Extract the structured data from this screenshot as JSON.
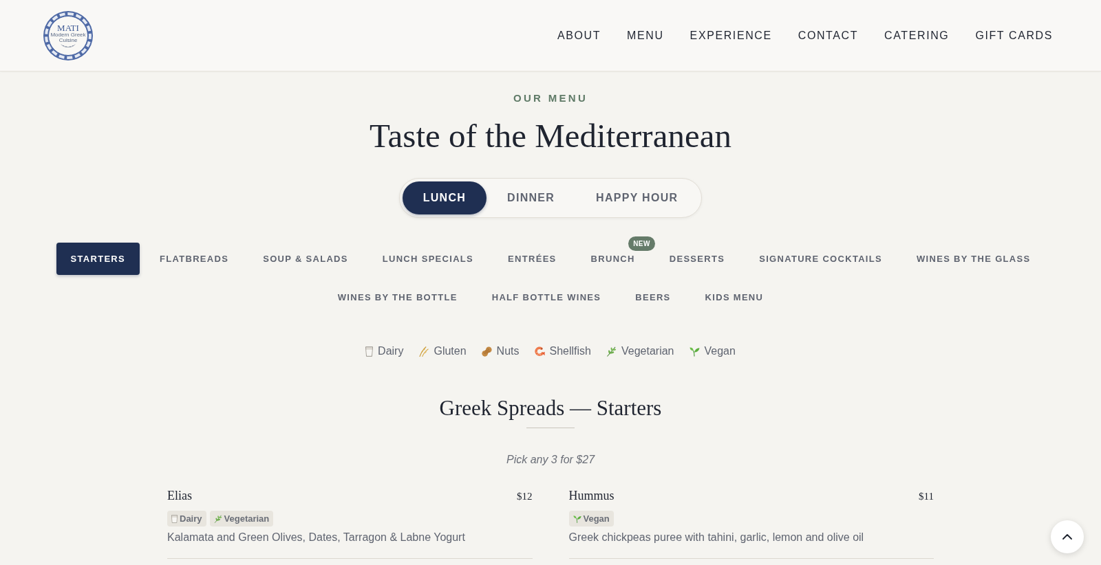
{
  "logo": {
    "wordmark": "MATI",
    "tagline": "Modern Greek Cuisine"
  },
  "nav": [
    {
      "label": "ABOUT"
    },
    {
      "label": "MENU"
    },
    {
      "label": "EXPERIENCE"
    },
    {
      "label": "CONTACT"
    },
    {
      "label": "CATERING"
    },
    {
      "label": "GIFT CARDS"
    }
  ],
  "menu_header": {
    "eyebrow": "OUR MENU",
    "title": "Taste of the Mediterranean"
  },
  "meal_tabs": [
    {
      "label": "LUNCH",
      "selected": true
    },
    {
      "label": "DINNER",
      "selected": false
    },
    {
      "label": "HAPPY HOUR",
      "selected": false
    }
  ],
  "categories": [
    {
      "label": "STARTERS",
      "selected": true
    },
    {
      "label": "FLATBREADS",
      "selected": false
    },
    {
      "label": "SOUP & SALADS",
      "selected": false
    },
    {
      "label": "LUNCH SPECIALS",
      "selected": false
    },
    {
      "label": "ENTRÉES",
      "selected": false
    },
    {
      "label": "BRUNCH",
      "selected": false,
      "badge": "NEW"
    },
    {
      "label": "DESSERTS",
      "selected": false
    },
    {
      "label": "SIGNATURE COCKTAILS",
      "selected": false
    },
    {
      "label": "WINES BY THE GLASS",
      "selected": false
    },
    {
      "label": "WINES BY THE BOTTLE",
      "selected": false
    },
    {
      "label": "HALF BOTTLE WINES",
      "selected": false
    },
    {
      "label": "BEERS",
      "selected": false
    },
    {
      "label": "KIDS MENU",
      "selected": false
    }
  ],
  "legend": [
    {
      "label": "Dairy",
      "kind": "dairy"
    },
    {
      "label": "Gluten",
      "kind": "gluten"
    },
    {
      "label": "Nuts",
      "kind": "nuts"
    },
    {
      "label": "Shellfish",
      "kind": "shellfish"
    },
    {
      "label": "Vegetarian",
      "kind": "vegetarian"
    },
    {
      "label": "Vegan",
      "kind": "vegan"
    }
  ],
  "section": {
    "title": "Greek Spreads — Starters",
    "note": "Pick any 3 for $27",
    "items": [
      {
        "name": "Elias",
        "price": "$12",
        "tags": [
          {
            "label": "Dairy",
            "kind": "dairy"
          },
          {
            "label": "Vegetarian",
            "kind": "vegetarian"
          }
        ],
        "description": "Kalamata and Green Olives, Dates, Tarragon & Labne Yogurt"
      },
      {
        "name": "Hummus",
        "price": "$11",
        "tags": [
          {
            "label": "Vegan",
            "kind": "vegan"
          }
        ],
        "description": "Greek chickpeas puree with tahini, garlic, lemon and olive oil"
      }
    ]
  }
}
